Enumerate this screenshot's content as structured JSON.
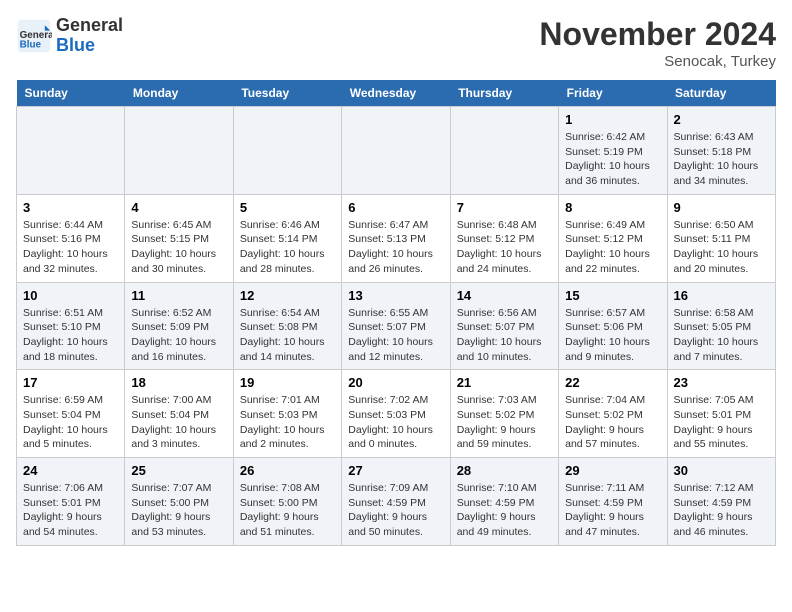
{
  "header": {
    "logo_general": "General",
    "logo_blue": "Blue",
    "title": "November 2024",
    "subtitle": "Senocak, Turkey"
  },
  "weekdays": [
    "Sunday",
    "Monday",
    "Tuesday",
    "Wednesday",
    "Thursday",
    "Friday",
    "Saturday"
  ],
  "weeks": [
    [
      {
        "day": "",
        "info": ""
      },
      {
        "day": "",
        "info": ""
      },
      {
        "day": "",
        "info": ""
      },
      {
        "day": "",
        "info": ""
      },
      {
        "day": "",
        "info": ""
      },
      {
        "day": "1",
        "info": "Sunrise: 6:42 AM\nSunset: 5:19 PM\nDaylight: 10 hours and 36 minutes."
      },
      {
        "day": "2",
        "info": "Sunrise: 6:43 AM\nSunset: 5:18 PM\nDaylight: 10 hours and 34 minutes."
      }
    ],
    [
      {
        "day": "3",
        "info": "Sunrise: 6:44 AM\nSunset: 5:16 PM\nDaylight: 10 hours and 32 minutes."
      },
      {
        "day": "4",
        "info": "Sunrise: 6:45 AM\nSunset: 5:15 PM\nDaylight: 10 hours and 30 minutes."
      },
      {
        "day": "5",
        "info": "Sunrise: 6:46 AM\nSunset: 5:14 PM\nDaylight: 10 hours and 28 minutes."
      },
      {
        "day": "6",
        "info": "Sunrise: 6:47 AM\nSunset: 5:13 PM\nDaylight: 10 hours and 26 minutes."
      },
      {
        "day": "7",
        "info": "Sunrise: 6:48 AM\nSunset: 5:12 PM\nDaylight: 10 hours and 24 minutes."
      },
      {
        "day": "8",
        "info": "Sunrise: 6:49 AM\nSunset: 5:12 PM\nDaylight: 10 hours and 22 minutes."
      },
      {
        "day": "9",
        "info": "Sunrise: 6:50 AM\nSunset: 5:11 PM\nDaylight: 10 hours and 20 minutes."
      }
    ],
    [
      {
        "day": "10",
        "info": "Sunrise: 6:51 AM\nSunset: 5:10 PM\nDaylight: 10 hours and 18 minutes."
      },
      {
        "day": "11",
        "info": "Sunrise: 6:52 AM\nSunset: 5:09 PM\nDaylight: 10 hours and 16 minutes."
      },
      {
        "day": "12",
        "info": "Sunrise: 6:54 AM\nSunset: 5:08 PM\nDaylight: 10 hours and 14 minutes."
      },
      {
        "day": "13",
        "info": "Sunrise: 6:55 AM\nSunset: 5:07 PM\nDaylight: 10 hours and 12 minutes."
      },
      {
        "day": "14",
        "info": "Sunrise: 6:56 AM\nSunset: 5:07 PM\nDaylight: 10 hours and 10 minutes."
      },
      {
        "day": "15",
        "info": "Sunrise: 6:57 AM\nSunset: 5:06 PM\nDaylight: 10 hours and 9 minutes."
      },
      {
        "day": "16",
        "info": "Sunrise: 6:58 AM\nSunset: 5:05 PM\nDaylight: 10 hours and 7 minutes."
      }
    ],
    [
      {
        "day": "17",
        "info": "Sunrise: 6:59 AM\nSunset: 5:04 PM\nDaylight: 10 hours and 5 minutes."
      },
      {
        "day": "18",
        "info": "Sunrise: 7:00 AM\nSunset: 5:04 PM\nDaylight: 10 hours and 3 minutes."
      },
      {
        "day": "19",
        "info": "Sunrise: 7:01 AM\nSunset: 5:03 PM\nDaylight: 10 hours and 2 minutes."
      },
      {
        "day": "20",
        "info": "Sunrise: 7:02 AM\nSunset: 5:03 PM\nDaylight: 10 hours and 0 minutes."
      },
      {
        "day": "21",
        "info": "Sunrise: 7:03 AM\nSunset: 5:02 PM\nDaylight: 9 hours and 59 minutes."
      },
      {
        "day": "22",
        "info": "Sunrise: 7:04 AM\nSunset: 5:02 PM\nDaylight: 9 hours and 57 minutes."
      },
      {
        "day": "23",
        "info": "Sunrise: 7:05 AM\nSunset: 5:01 PM\nDaylight: 9 hours and 55 minutes."
      }
    ],
    [
      {
        "day": "24",
        "info": "Sunrise: 7:06 AM\nSunset: 5:01 PM\nDaylight: 9 hours and 54 minutes."
      },
      {
        "day": "25",
        "info": "Sunrise: 7:07 AM\nSunset: 5:00 PM\nDaylight: 9 hours and 53 minutes."
      },
      {
        "day": "26",
        "info": "Sunrise: 7:08 AM\nSunset: 5:00 PM\nDaylight: 9 hours and 51 minutes."
      },
      {
        "day": "27",
        "info": "Sunrise: 7:09 AM\nSunset: 4:59 PM\nDaylight: 9 hours and 50 minutes."
      },
      {
        "day": "28",
        "info": "Sunrise: 7:10 AM\nSunset: 4:59 PM\nDaylight: 9 hours and 49 minutes."
      },
      {
        "day": "29",
        "info": "Sunrise: 7:11 AM\nSunset: 4:59 PM\nDaylight: 9 hours and 47 minutes."
      },
      {
        "day": "30",
        "info": "Sunrise: 7:12 AM\nSunset: 4:59 PM\nDaylight: 9 hours and 46 minutes."
      }
    ]
  ]
}
